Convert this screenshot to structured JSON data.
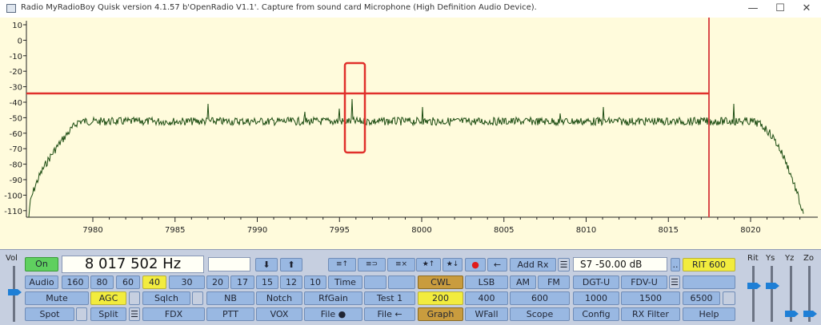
{
  "window": {
    "title": "Radio MyRadioBoy   Quisk version 4.1.57   b'OpenRadio V1.1'. Capture from sound card Microphone (High Definition Audio Device).",
    "minimize": "—",
    "maximize": "☐",
    "close": "✕"
  },
  "graph": {
    "y_labels": [
      "10",
      "0",
      "-10",
      "-20",
      "-30",
      "-40",
      "-50",
      "-60",
      "-70",
      "-80",
      "-90",
      "-100",
      "-110"
    ],
    "x_labels": [
      "7980",
      "7985",
      "7990",
      "7995",
      "8000",
      "8005",
      "8010",
      "8015",
      "8020"
    ],
    "rit_line_color": "#d94a4a",
    "trace_color": "#1d4d12",
    "highlight_color": "#e0302b"
  },
  "controls": {
    "on": "On",
    "frequency": "8 017 502 Hz",
    "freq_entry": "",
    "down_arrow": "⬇",
    "up_arrow": "⬆",
    "mem1": "≡↑",
    "mem2": "≡⊃",
    "mem3": "≡×",
    "star_up": "★↑",
    "star_down": "★↓",
    "record": "●",
    "back": "←",
    "add_rx": "Add Rx",
    "menu_icon": "☰",
    "smeter": "S7   -50.00 dB",
    "dotdot": "..",
    "rit": "RIT 600",
    "audio": "Audio",
    "band_160": "160",
    "band_80": "80",
    "band_60": "60",
    "band_40": "40",
    "band_30": "30",
    "band_20": "20",
    "band_17": "17",
    "band_15": "15",
    "band_12": "12",
    "band_10": "10",
    "time": "Time",
    "mute": "Mute",
    "agc": "AGC",
    "sqlch": "Sqlch",
    "nb": "NB",
    "notch": "Notch",
    "rfgain": "RfGain",
    "test1": "Test 1",
    "spot": "Spot",
    "split": "Split",
    "fdx": "FDX",
    "ptt": "PTT",
    "vox": "VOX",
    "file1": "File ●",
    "file2": "File ←",
    "cwl": "CWL",
    "lsb": "LSB",
    "am": "AM",
    "fm": "FM",
    "dgtu": "DGT-U",
    "fdvu": "FDV-U",
    "bw_200": "200",
    "bw_400": "400",
    "bw_600": "600",
    "bw_1000": "1000",
    "bw_1500": "1500",
    "bw_6500": "6500",
    "graph": "Graph",
    "wfall": "WFall",
    "scope": "Scope",
    "config": "Config",
    "rxfilter": "RX Filter",
    "help": "Help",
    "vol": "Vol",
    "rit_label": "Rit",
    "ys": "Ys",
    "yz": "Yz",
    "zo": "Zo"
  }
}
